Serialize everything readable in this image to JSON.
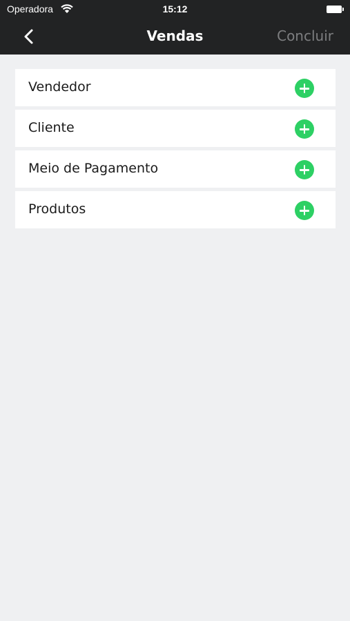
{
  "status_bar": {
    "carrier": "Operadora",
    "time": "15:12",
    "icons": [
      "wifi-icon",
      "battery-icon"
    ]
  },
  "nav": {
    "back_icon": "chevron-left-icon",
    "title": "Vendas",
    "action_label": "Concluir"
  },
  "sections": [
    {
      "label": "Vendedor",
      "icon": "add-circle-icon"
    },
    {
      "label": "Cliente",
      "icon": "add-circle-icon"
    },
    {
      "label": "Meio de Pagamento",
      "icon": "add-circle-icon"
    },
    {
      "label": "Produtos",
      "icon": "add-circle-icon"
    }
  ],
  "colors": {
    "header_bg": "#222324",
    "page_bg": "#eff0f2",
    "accent_green": "#2dd064",
    "disabled_action": "#7d7e80"
  }
}
